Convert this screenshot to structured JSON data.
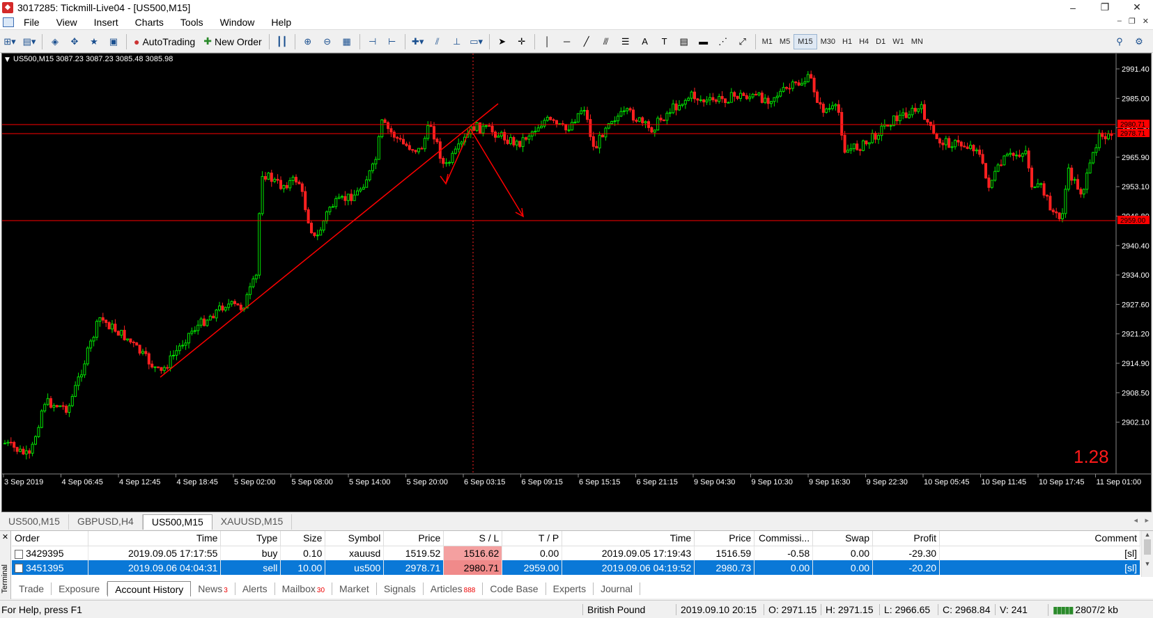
{
  "window": {
    "title": "3017285: Tickmill-Live04 - [US500,M15]",
    "controls": [
      "–",
      "❐",
      "✕"
    ]
  },
  "menu": [
    "File",
    "View",
    "Insert",
    "Charts",
    "Tools",
    "Window",
    "Help"
  ],
  "toolbar": {
    "autotrading_label": "AutoTrading",
    "new_order_label": "New Order",
    "timeframes": [
      "M1",
      "M5",
      "M15",
      "M30",
      "H1",
      "H4",
      "D1",
      "W1",
      "MN"
    ],
    "active_timeframe": "M15"
  },
  "chart": {
    "header": "US500,M15  3087.23 3087.23 3085.48 3085.98",
    "price_labels": [
      "2991.40",
      "2985.00",
      "2972.30",
      "2965.90",
      "2953.10",
      "2946.80",
      "2940.40",
      "2934.00",
      "2927.60",
      "2921.20",
      "2914.90",
      "2908.50",
      "2902.10"
    ],
    "level_labels": [
      "2980.71",
      "2978.71",
      "2959.00"
    ],
    "time_labels": [
      "3 Sep 2019",
      "4 Sep 06:45",
      "4 Sep 12:45",
      "4 Sep 18:45",
      "5 Sep 02:00",
      "5 Sep 08:00",
      "5 Sep 14:00",
      "5 Sep 20:00",
      "6 Sep 03:15",
      "6 Sep 09:15",
      "6 Sep 15:15",
      "6 Sep 21:15",
      "9 Sep 04:30",
      "9 Sep 10:30",
      "9 Sep 16:30",
      "9 Sep 22:30",
      "10 Sep 05:45",
      "10 Sep 11:45",
      "10 Sep 17:45",
      "11 Sep 01:00"
    ],
    "corner_value": "1.28",
    "colors": {
      "up": "#00e600",
      "down": "#ff2020",
      "line": "#ff0000",
      "bg": "#000000"
    }
  },
  "chart_tabs": [
    "US500,M15",
    "GBPUSD,H4",
    "US500,M15",
    "XAUUSD,M15"
  ],
  "active_chart_tab": 2,
  "terminal": {
    "side_label": "Terminal",
    "columns": [
      "Order",
      "Time",
      "Type",
      "Size",
      "Symbol",
      "Price",
      "S / L",
      "T / P",
      "Time",
      "Price",
      "Commissi...",
      "Swap",
      "Profit",
      "Comment"
    ],
    "rows": [
      [
        "3429395",
        "2019.09.05 17:17:55",
        "buy",
        "0.10",
        "xauusd",
        "1519.52",
        "1516.62",
        "0.00",
        "2019.09.05 17:19:43",
        "1516.59",
        "-0.58",
        "0.00",
        "-29.30",
        "[sl]"
      ],
      [
        "3451395",
        "2019.09.06 04:04:31",
        "sell",
        "10.00",
        "us500",
        "2978.71",
        "2980.71",
        "2959.00",
        "2019.09.06 04:19:52",
        "2980.73",
        "0.00",
        "0.00",
        "-20.20",
        "[sl]"
      ]
    ],
    "selected_row": 1,
    "tabs": [
      {
        "label": "Trade",
        "badge": ""
      },
      {
        "label": "Exposure",
        "badge": ""
      },
      {
        "label": "Account History",
        "badge": ""
      },
      {
        "label": "News",
        "badge": "3"
      },
      {
        "label": "Alerts",
        "badge": ""
      },
      {
        "label": "Mailbox",
        "badge": "30"
      },
      {
        "label": "Market",
        "badge": ""
      },
      {
        "label": "Signals",
        "badge": ""
      },
      {
        "label": "Articles",
        "badge": "888"
      },
      {
        "label": "Code Base",
        "badge": ""
      },
      {
        "label": "Experts",
        "badge": ""
      },
      {
        "label": "Journal",
        "badge": ""
      }
    ],
    "active_tab": 2
  },
  "status": {
    "help": "For Help, press F1",
    "profile": "British Pound",
    "datetime": "2019.09.10 20:15",
    "open": "O: 2971.15",
    "high": "H: 2971.15",
    "low": "L: 2966.65",
    "close": "C: 2968.84",
    "volume": "V: 241",
    "traffic": "2807/2 kb"
  }
}
